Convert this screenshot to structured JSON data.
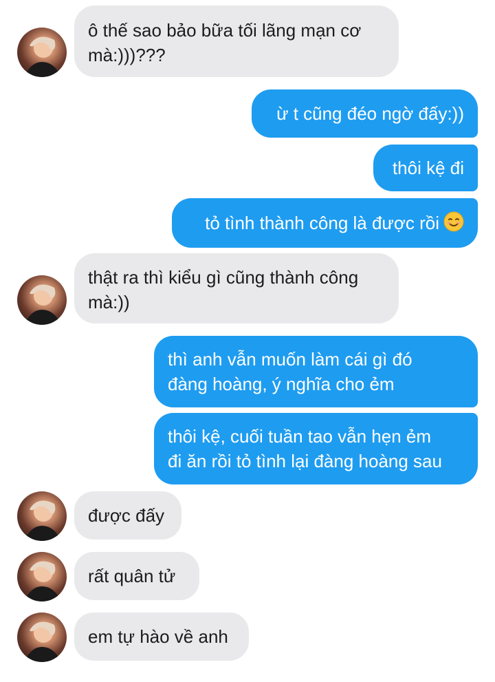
{
  "messages": [
    {
      "from": "friend",
      "lines": [
        "ô thế sao bảo bữa tối lãng mạn cơ",
        "mà:)))???"
      ]
    },
    {
      "from": "me",
      "lines": [
        "ừ t cũng đéo ngờ đấy:))"
      ]
    },
    {
      "from": "me",
      "lines": [
        "thôi kệ đi"
      ]
    },
    {
      "from": "me",
      "lines": [
        "tỏ tình thành công là được rồi"
      ],
      "emoji": "smiling-face-icon"
    },
    {
      "from": "friend",
      "lines": [
        "thật ra thì kiểu gì cũng thành công",
        "mà:))"
      ]
    },
    {
      "from": "me",
      "lines": [
        "thì anh vẫn muốn làm cái gì đó",
        "đàng hoàng, ý nghĩa cho ẻm"
      ]
    },
    {
      "from": "me",
      "lines": [
        "thôi kệ, cuối tuần tao vẫn hẹn ẻm",
        "đi ăn rồi tỏ tình lại đàng hoàng sau"
      ]
    },
    {
      "from": "friend",
      "lines": [
        "được đấy"
      ]
    },
    {
      "from": "friend",
      "lines": [
        "rất quân tử"
      ]
    },
    {
      "from": "friend",
      "lines": [
        "em tự hào về anh"
      ]
    }
  ],
  "colors": {
    "outgoing_bubble": "#1e9cf0",
    "incoming_bubble": "#e9e9eb",
    "outgoing_text": "#ffffff",
    "incoming_text": "#1c1c1c"
  }
}
